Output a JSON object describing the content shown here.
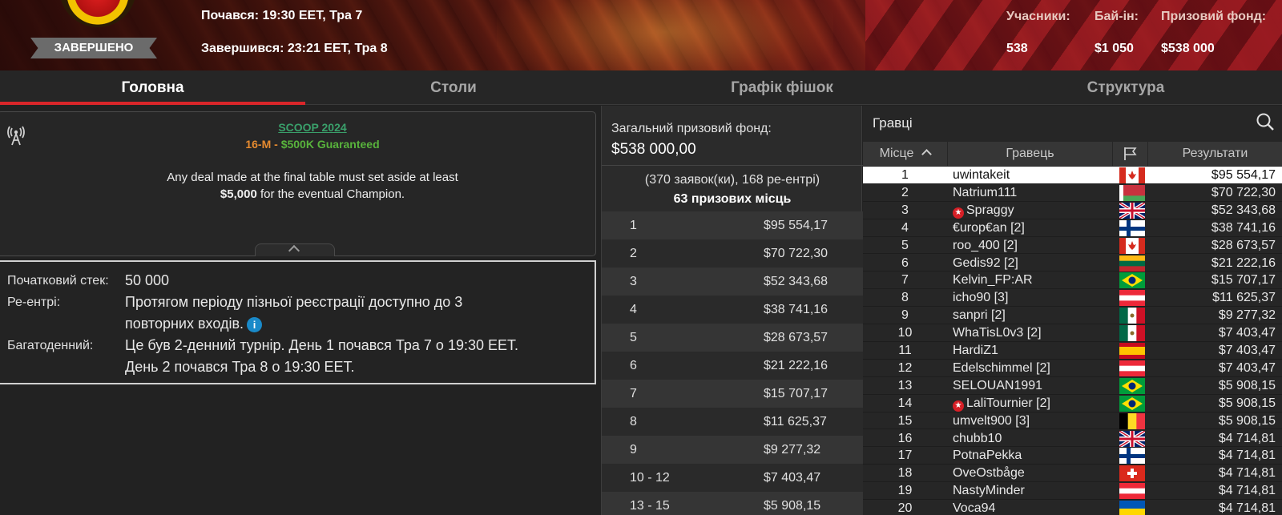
{
  "header": {
    "status": "ЗАВЕРШЕНО",
    "started": "Почався: 19:30 EET, Тра 7",
    "finished": "Завершився: 23:21 EET, Тра 8",
    "stats": [
      {
        "label": "Учасники:",
        "value": "538"
      },
      {
        "label": "Бай-ін:",
        "value": "$1 050"
      },
      {
        "label": "Призовий фонд:",
        "value": "$538 000"
      }
    ],
    "logo_icon": "scoop-logo"
  },
  "tabs": [
    {
      "label": "Головна",
      "active": true
    },
    {
      "label": "Столи",
      "active": false
    },
    {
      "label": "Графік фішок",
      "active": false
    },
    {
      "label": "Структура",
      "active": false
    }
  ],
  "event": {
    "series_link": "SCOOP 2024",
    "code": "16-M",
    "separator": "-",
    "guarantee": "$500K Guaranteed",
    "deal_note_line1": "Any deal made at the final table must set aside at least",
    "deal_note_line2_bold": "$5,000",
    "deal_note_line2_rest": "for the eventual Champion.",
    "broadcast_icon": "tower-broadcast-icon"
  },
  "details": {
    "starting_stack_label": "Початковий стек:",
    "starting_stack_value": "50 000",
    "reentry_label": "Ре-ентрі:",
    "reentry_value_line1": "Протягом періоду пізньої реєстрації доступно до 3",
    "reentry_value_line2": "повторних входів.",
    "info_icon_glyph": "i",
    "multiday_label": "Багатоденний:",
    "multiday_value_line1": "Це був 2-денний турнір. День 1 почався Тра 7 о 19:30 EET.",
    "multiday_value_line2": "День 2 почався Тра 8 о 19:30 EET."
  },
  "prize_pool": {
    "label": "Загальний призовий фонд:",
    "value": "$538 000,00",
    "entries": "(370 заявок(ки), 168 ре-ентрі)",
    "places": "63 призових місць",
    "rows": [
      {
        "place": "1",
        "amount": "$95 554,17"
      },
      {
        "place": "2",
        "amount": "$70 722,30"
      },
      {
        "place": "3",
        "amount": "$52 343,68"
      },
      {
        "place": "4",
        "amount": "$38 741,16"
      },
      {
        "place": "5",
        "amount": "$28 673,57"
      },
      {
        "place": "6",
        "amount": "$21 222,16"
      },
      {
        "place": "7",
        "amount": "$15 707,17"
      },
      {
        "place": "8",
        "amount": "$11 625,37"
      },
      {
        "place": "9",
        "amount": "$9 277,32"
      },
      {
        "place": "10 - 12",
        "amount": "$7 403,47"
      },
      {
        "place": "13 - 15",
        "amount": "$5 908,15"
      }
    ]
  },
  "players": {
    "title": "Гравці",
    "columns": {
      "place": "Місце",
      "player": "Гравець",
      "result": "Результати"
    },
    "rows": [
      {
        "pos": "1",
        "name": "uwintakeit",
        "star": false,
        "flag": "canada",
        "result": "$95 554,17"
      },
      {
        "pos": "2",
        "name": "Natrium111",
        "star": false,
        "flag": "belarus",
        "result": "$70 722,30"
      },
      {
        "pos": "3",
        "name": "Spraggy",
        "star": true,
        "flag": "uk",
        "result": "$52 343,68"
      },
      {
        "pos": "4",
        "name": "€urop€an [2]",
        "star": false,
        "flag": "finland",
        "result": "$38 741,16"
      },
      {
        "pos": "5",
        "name": "roo_400 [2]",
        "star": false,
        "flag": "canada",
        "result": "$28 673,57"
      },
      {
        "pos": "6",
        "name": "Gedis92 [2]",
        "star": false,
        "flag": "lithuania",
        "result": "$21 222,16"
      },
      {
        "pos": "7",
        "name": "Kelvin_FP:AR",
        "star": false,
        "flag": "brazil",
        "result": "$15 707,17"
      },
      {
        "pos": "8",
        "name": "icho90 [3]",
        "star": false,
        "flag": "austria",
        "result": "$11 625,37"
      },
      {
        "pos": "9",
        "name": "sanpri [2]",
        "star": false,
        "flag": "mexico",
        "result": "$9 277,32"
      },
      {
        "pos": "10",
        "name": "WhaTisL0v3 [2]",
        "star": false,
        "flag": "mexico",
        "result": "$7 403,47"
      },
      {
        "pos": "11",
        "name": "HardiZ1",
        "star": false,
        "flag": "spain",
        "result": "$7 403,47"
      },
      {
        "pos": "12",
        "name": "Edelschimmel [2]",
        "star": false,
        "flag": "austria",
        "result": "$7 403,47"
      },
      {
        "pos": "13",
        "name": "SELOUAN1991",
        "star": false,
        "flag": "brazil",
        "result": "$5 908,15"
      },
      {
        "pos": "14",
        "name": "LaliTournier [2]",
        "star": true,
        "flag": "brazil",
        "result": "$5 908,15"
      },
      {
        "pos": "15",
        "name": "umvelt900 [3]",
        "star": false,
        "flag": "belgium",
        "result": "$5 908,15"
      },
      {
        "pos": "16",
        "name": "chubb10",
        "star": false,
        "flag": "uk",
        "result": "$4 714,81"
      },
      {
        "pos": "17",
        "name": "PotnaPekka",
        "star": false,
        "flag": "finland",
        "result": "$4 714,81"
      },
      {
        "pos": "18",
        "name": "OveOstbåge",
        "star": false,
        "flag": "switzerland",
        "result": "$4 714,81"
      },
      {
        "pos": "19",
        "name": "NastyMinder",
        "star": false,
        "flag": "austria",
        "result": "$4 714,81"
      },
      {
        "pos": "20",
        "name": "Voca94",
        "star": false,
        "flag": "ukraine",
        "result": "$4 714,81"
      }
    ]
  },
  "colors": {
    "accent_red": "#d9262a",
    "link_green": "#3aa06b",
    "event_orange": "#e58a2f",
    "guarantee_green": "#58b33c",
    "info_blue": "#1a8ac9"
  }
}
